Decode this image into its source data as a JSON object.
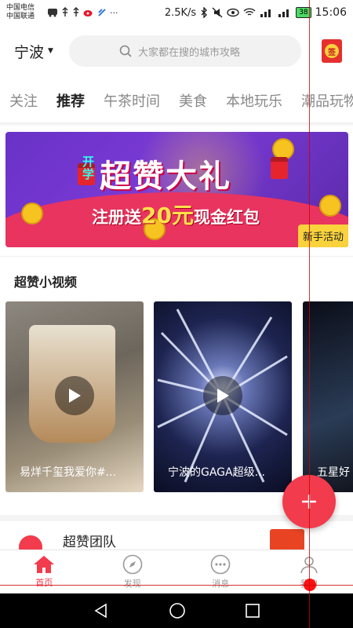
{
  "status_bar": {
    "carrier_1": "中国电信",
    "carrier_2": "中国联通",
    "speed": "2.5K/s",
    "battery": "38",
    "time": "15:06",
    "signal_labels": [
      "4G",
      "2G"
    ]
  },
  "topbar": {
    "city": "宁波",
    "search_placeholder": "大家都在搜的城市攻略",
    "checkin_label": "签"
  },
  "tabs": [
    {
      "label": "关注",
      "active": false
    },
    {
      "label": "推荐",
      "active": true
    },
    {
      "label": "午茶时间",
      "active": false
    },
    {
      "label": "美食",
      "active": false
    },
    {
      "label": "本地玩乐",
      "active": false
    },
    {
      "label": "潮品玩物",
      "active": false
    }
  ],
  "banner": {
    "tag": "开学",
    "title": "超赞大礼",
    "subtitle_pre": "注册送",
    "subtitle_amount": "20元",
    "subtitle_post": "现金红包",
    "badge": "新手活动"
  },
  "videos_section": {
    "title": "超赞小视频",
    "items": [
      {
        "caption": "易烊千玺我爱你#..."
      },
      {
        "caption": "宁波的GAGA超级..."
      },
      {
        "caption": "五星好"
      }
    ]
  },
  "feed_item": {
    "name": "超赞团队"
  },
  "bottom_nav": [
    {
      "label": "首页",
      "active": true,
      "icon": "home-icon"
    },
    {
      "label": "发现",
      "active": false,
      "icon": "compass-icon"
    },
    {
      "label": "消息",
      "active": false,
      "icon": "message-icon"
    },
    {
      "label": "我的",
      "active": false,
      "icon": "profile-icon"
    }
  ],
  "colors": {
    "accent": "#f23b4c",
    "banner_purple": "#6a32c7",
    "badge_yellow": "#f9d23c"
  }
}
